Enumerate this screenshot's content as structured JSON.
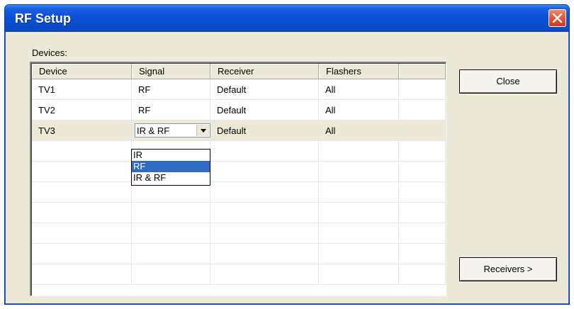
{
  "window": {
    "title": "RF Setup"
  },
  "devices_label": "Devices:",
  "table": {
    "columns": [
      "Device",
      "Signal",
      "Receiver",
      "Flashers",
      ""
    ],
    "rows": [
      {
        "device": "TV1",
        "signal": "RF",
        "receiver": "Default",
        "flashers": "All"
      },
      {
        "device": "TV2",
        "signal": "RF",
        "receiver": "Default",
        "flashers": "All"
      },
      {
        "device": "TV3",
        "signal": "IR & RF",
        "receiver": "Default",
        "flashers": "All"
      }
    ]
  },
  "signal_dropdown": {
    "selected_value": "IR & RF",
    "options": [
      "IR",
      "RF",
      "IR & RF"
    ],
    "highlighted": "RF"
  },
  "buttons": {
    "close_label": "Close",
    "receivers_label": "Receivers >"
  },
  "colors": {
    "titlebar": "#0a4fd6",
    "selection": "#316ac5",
    "close_button": "#e0553a"
  }
}
